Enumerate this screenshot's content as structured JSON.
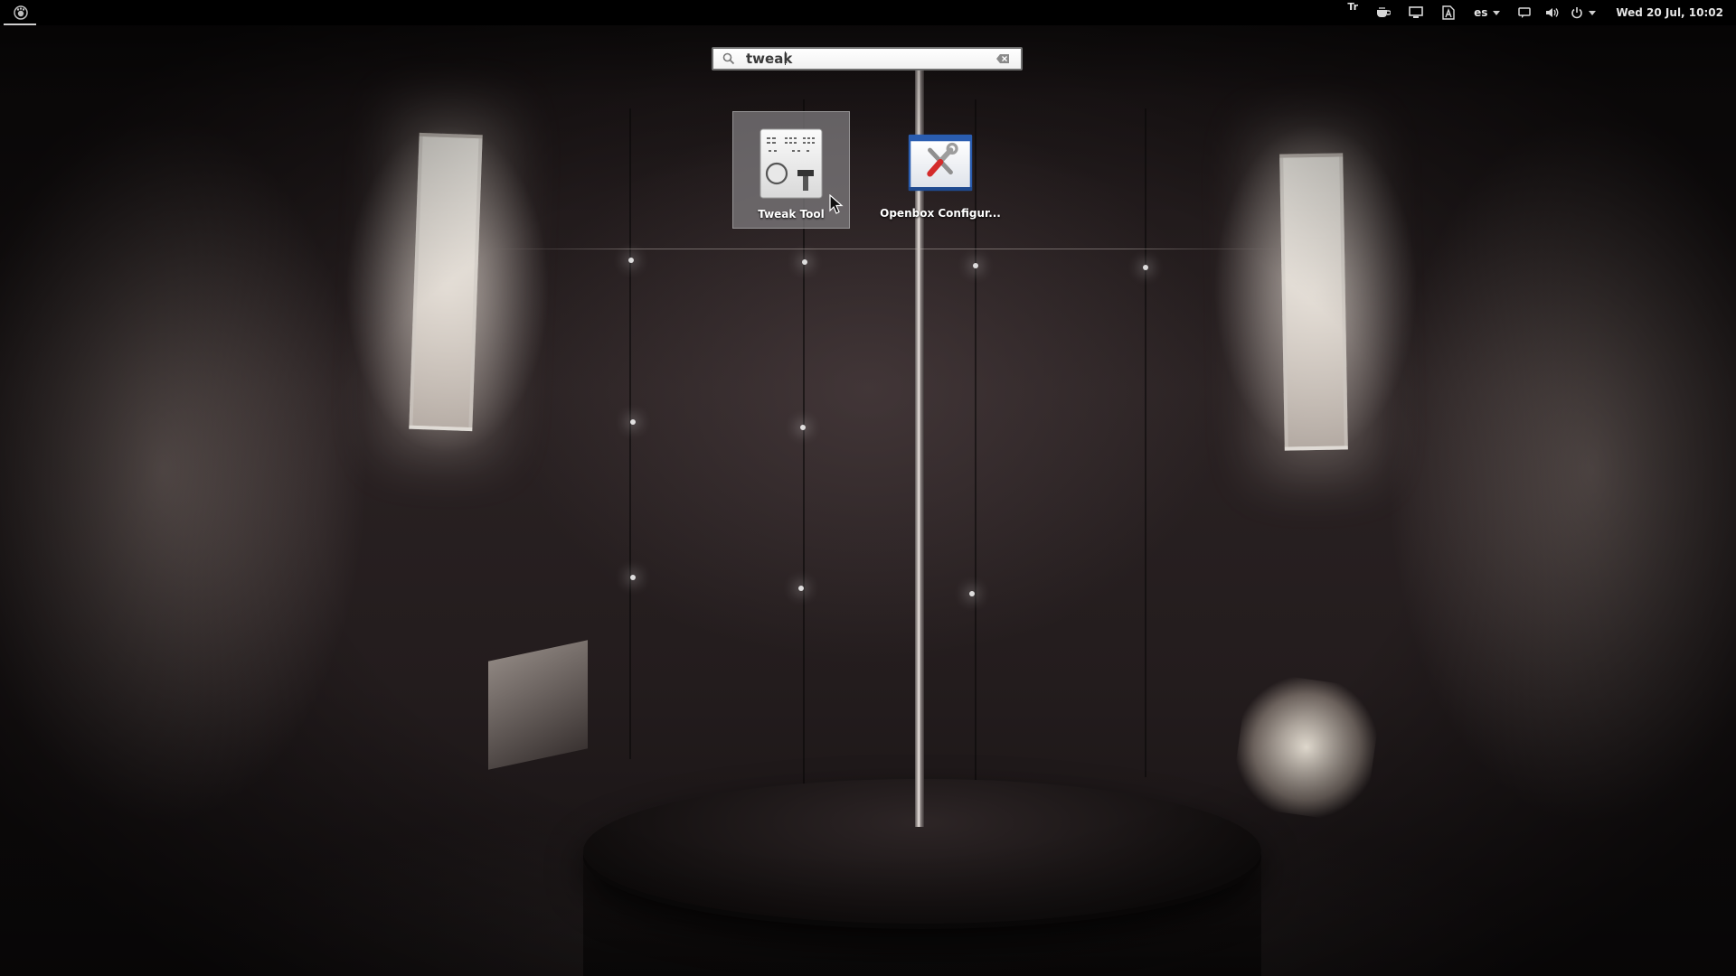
{
  "panel": {
    "activities_icon": "gnome-foot-icon",
    "tray": {
      "tr_label": "Tr",
      "keyboard_layout": "es",
      "clock": "Wed 20 Jul, 10:02",
      "icons": [
        "coffee-icon",
        "display-icon",
        "font-app-icon",
        "chat-icon",
        "volume-icon",
        "power-icon"
      ]
    }
  },
  "search": {
    "value": "tweak",
    "icons": [
      "search-icon",
      "clear-icon"
    ]
  },
  "results": [
    {
      "label": "Tweak Tool",
      "icon": "tweak-tool-icon",
      "selected": true
    },
    {
      "label": "Openbox Configur...",
      "icon": "openbox-config-icon",
      "selected": false
    }
  ],
  "colors": {
    "panel_bg": "#000000",
    "panel_text": "#e6e6e6",
    "selection_bg": "#828082",
    "openbox_blue": "#2a5db0"
  }
}
